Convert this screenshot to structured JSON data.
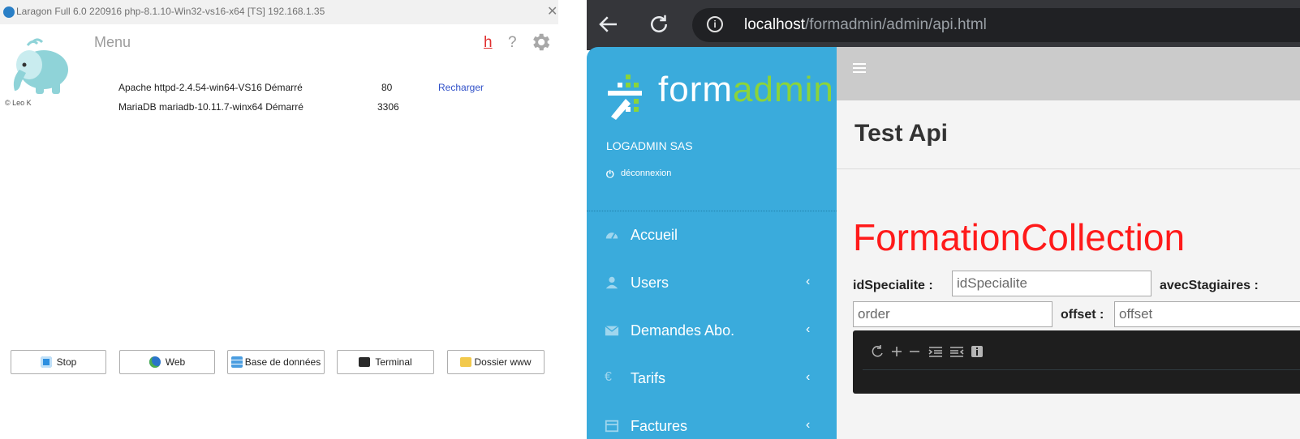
{
  "laragon": {
    "title": "Laragon Full 6.0 220916 php-8.1.10-Win32-vs16-x64 [TS]  192.168.1.35",
    "close": "✕",
    "menu": "Menu",
    "h": "h",
    "help": "?",
    "copyright": "© Leo K",
    "services": [
      {
        "name": "Apache httpd-2.4.54-win64-VS16 Démarré",
        "port": "80",
        "action": "Recharger"
      },
      {
        "name": "MariaDB mariadb-10.11.7-winx64 Démarré",
        "port": "3306",
        "action": ""
      }
    ],
    "buttons": {
      "stop": "Stop",
      "web": "Web",
      "database": "Base de données",
      "terminal": "Terminal",
      "www": "Dossier www"
    },
    "icons": {
      "gear": "gear-icon",
      "elephant": "elephant-logo"
    }
  },
  "browser": {
    "url_host": "localhost",
    "url_path": "/formadmin/admin/api.html",
    "info": "i",
    "icons": {
      "back": "back-arrow-icon",
      "reload": "reload-icon"
    }
  },
  "app": {
    "brand_prefix": "form",
    "brand_suffix": "admin",
    "company": "LOGADMIN SAS",
    "logout": "déconnexion",
    "nav": [
      {
        "label": "Accueil",
        "icon": "dashboard-icon",
        "chevron": ""
      },
      {
        "label": "Users",
        "icon": "user-icon",
        "chevron": "‹"
      },
      {
        "label": "Demandes Abo.",
        "icon": "envelope-icon",
        "chevron": "‹"
      },
      {
        "label": "Tarifs",
        "icon": "euro-icon",
        "chevron": "‹"
      },
      {
        "label": "Factures",
        "icon": "invoice-icon",
        "chevron": "‹"
      }
    ],
    "page_title": "Test Api",
    "collection_title": "FormationCollection",
    "filters": {
      "idSpecialite_label": "idSpecialite :",
      "idSpecialite_placeholder": "idSpecialite",
      "avecStagiaires_label": "avecStagiaires :",
      "order_placeholder": "order",
      "offset_label": "offset :",
      "offset_placeholder": "offset"
    },
    "colors": {
      "sidebar": "#3aabdc",
      "brand_green": "#8bd43a",
      "collection_title": "#ff1a1a"
    }
  }
}
